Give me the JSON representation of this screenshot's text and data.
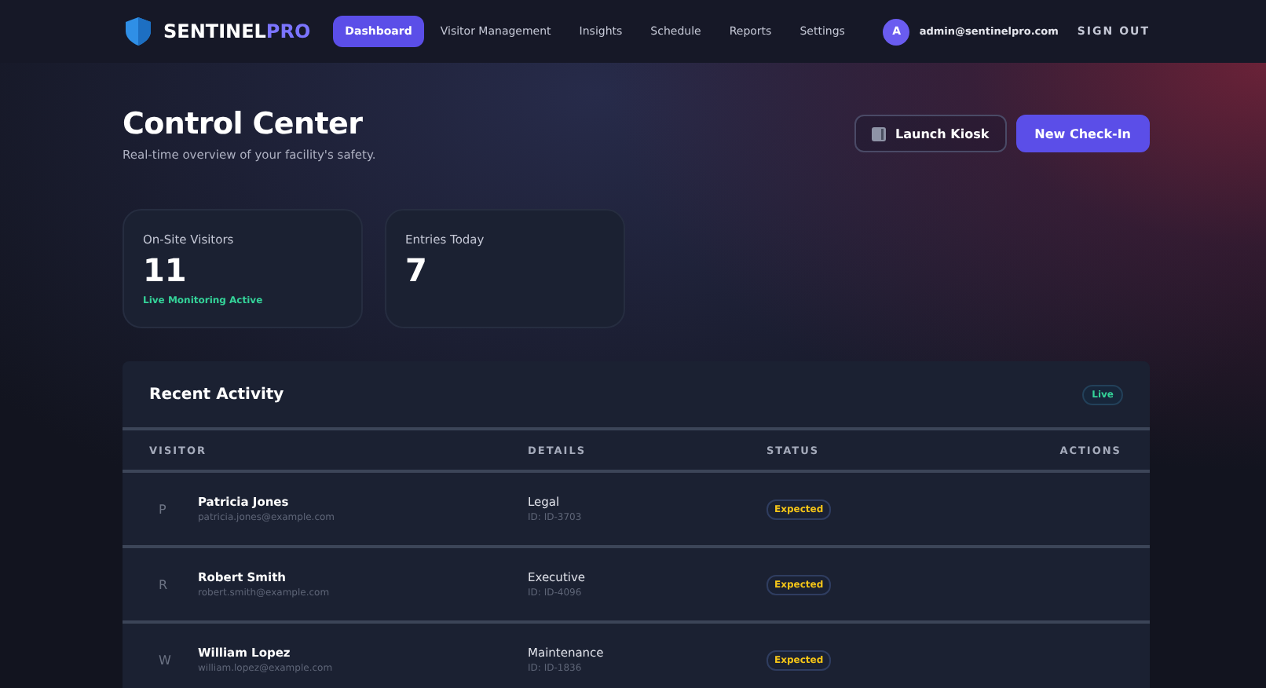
{
  "brand": {
    "name": "SENTINEL",
    "accent": "PRO"
  },
  "nav": [
    {
      "label": "Dashboard",
      "selected": true
    },
    {
      "label": "Visitor Management",
      "selected": false
    },
    {
      "label": "Insights",
      "selected": false
    },
    {
      "label": "Schedule",
      "selected": false
    },
    {
      "label": "Reports",
      "selected": false
    },
    {
      "label": "Settings",
      "selected": false
    }
  ],
  "user": {
    "initial": "A",
    "email": "admin@sentinelpro.com",
    "sign_out": "SIGN OUT"
  },
  "page": {
    "title": "Control Center",
    "subtitle": "Real-time overview of your facility's safety."
  },
  "actions": [
    {
      "label": "Launch Kiosk",
      "kind": "secondary"
    },
    {
      "label": "New Check-In",
      "kind": "primary"
    }
  ],
  "stats": [
    {
      "label": "On-Site Visitors",
      "value": "11",
      "note": "Live Monitoring Active"
    },
    {
      "label": "Entries Today",
      "value": "7"
    }
  ],
  "activity": {
    "title": "Recent Activity",
    "badge": "Live",
    "columns": [
      "VISITOR",
      "DETAILS",
      "STATUS",
      "ACTIONS"
    ],
    "rows": [
      {
        "initial": "P",
        "name": "Patricia Jones",
        "email": "patricia.jones@example.com",
        "department": "Legal",
        "id": "ID: ID-3703",
        "status": "Expected",
        "kind": "expected"
      },
      {
        "initial": "R",
        "name": "Robert Smith",
        "email": "robert.smith@example.com",
        "department": "Executive",
        "id": "ID: ID-4096",
        "status": "Expected",
        "kind": "expected"
      },
      {
        "initial": "W",
        "name": "William Lopez",
        "email": "william.lopez@example.com",
        "department": "Maintenance",
        "id": "ID: ID-1836",
        "status": "Expected",
        "kind": "expected"
      }
    ]
  }
}
